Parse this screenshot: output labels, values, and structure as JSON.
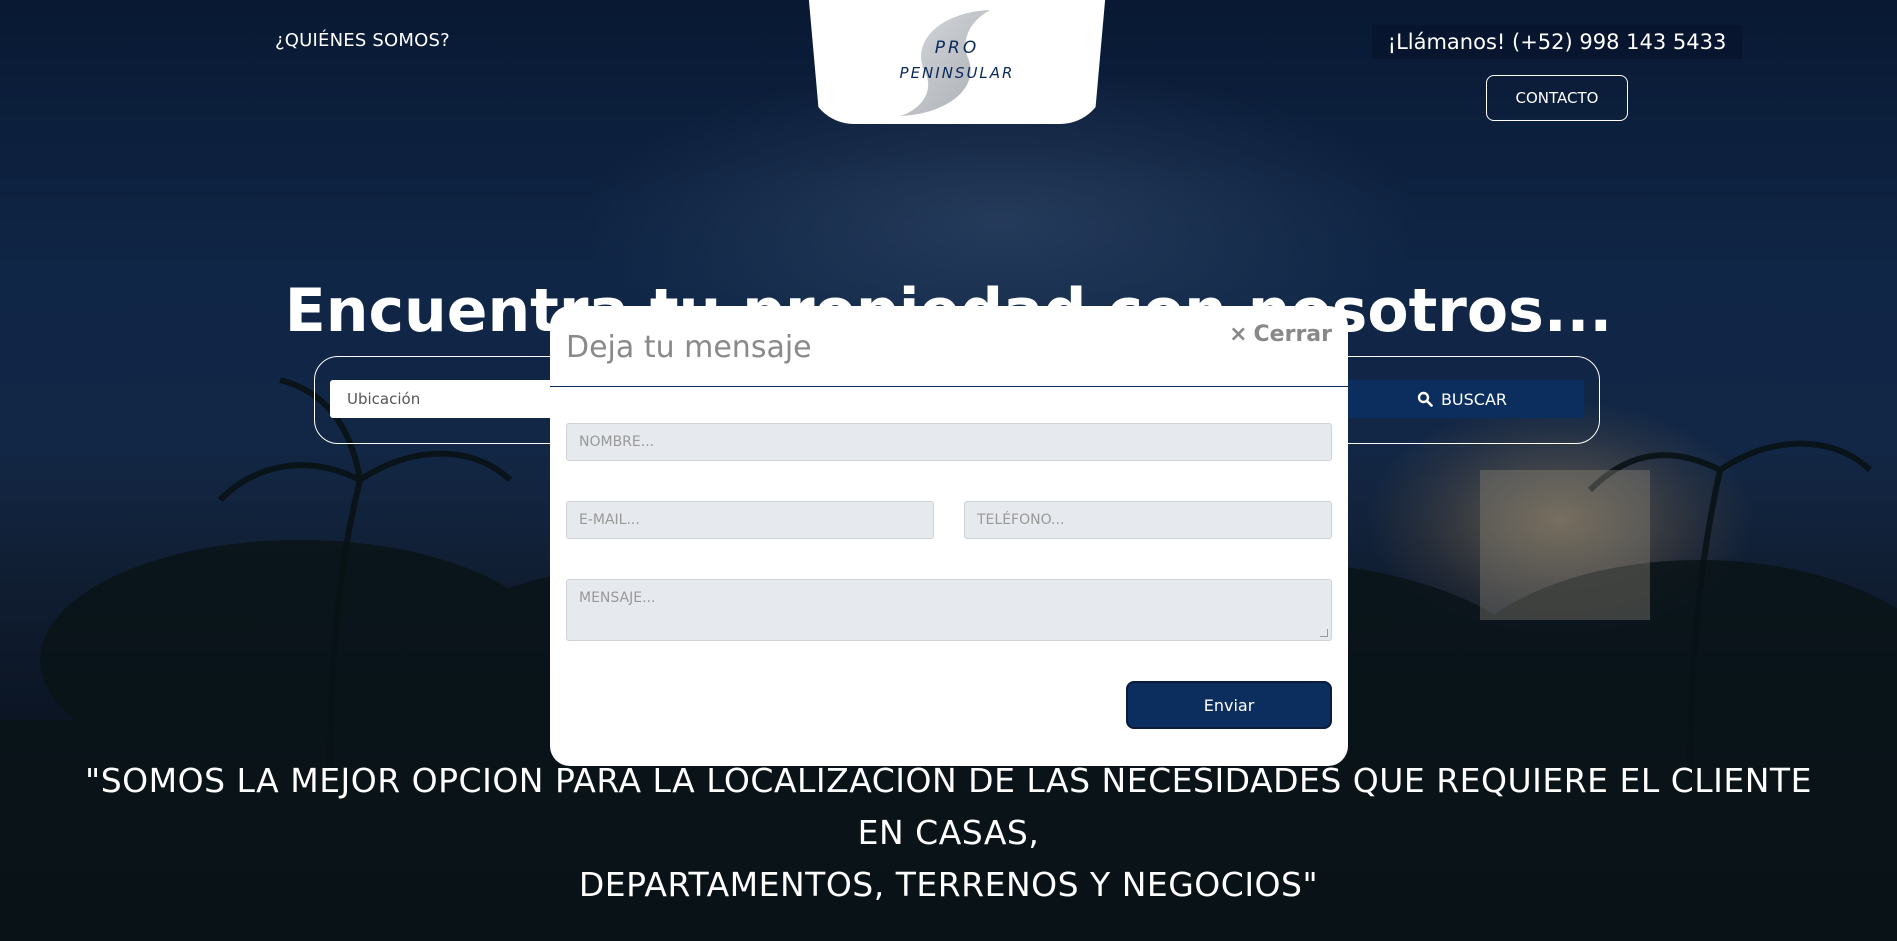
{
  "header": {
    "nav_about": "¿QUIÉNES SOMOS?",
    "logo_line1": "PRO",
    "logo_line2": "PENINSULAR",
    "phone": "¡Llámanos! (+52) 998 143 5433",
    "contact_label": "CONTACTO"
  },
  "hero": {
    "title": "Encuentra tu propiedad con nosotros...",
    "location_placeholder": "Ubicación",
    "search_label": "BUSCAR",
    "tagline_line1": "\"SOMOS LA MEJOR OPCION PARA LA LOCALIZACION DE LAS NECESIDADES QUE REQUIERE EL CLIENTE EN CASAS,",
    "tagline_line2": "DEPARTAMENTOS, TERRENOS Y NEGOCIOS\""
  },
  "modal": {
    "title": "Deja tu mensaje",
    "close_label": "Cerrar",
    "name_placeholder": "NOMBRE...",
    "email_placeholder": "E-MAIL...",
    "phone_placeholder": "TELÉFONO...",
    "message_placeholder": "MENSAJE...",
    "send_label": "Enviar"
  },
  "colors": {
    "navy": "#0b2e5e",
    "phone_bg": "#07152e",
    "field_bg": "#e6e9ed"
  }
}
